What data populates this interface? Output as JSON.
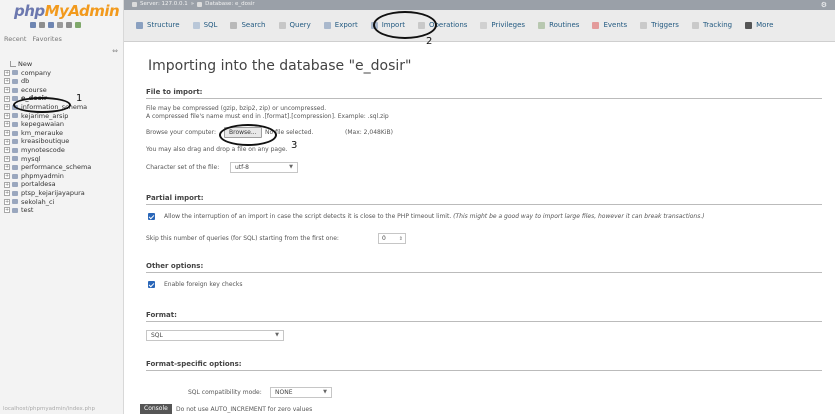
{
  "app": {
    "logo_left": "php",
    "logo_right": "MyAdmin",
    "nav_tabs": [
      "Recent",
      "Favorites"
    ],
    "collapse_glyph": "⇔",
    "status_url": "localhost/phpmyadmin/index.php"
  },
  "tree": [
    {
      "label": "New",
      "kind": "new"
    },
    {
      "label": "company",
      "kind": "db"
    },
    {
      "label": "db",
      "kind": "db"
    },
    {
      "label": "ecourse",
      "kind": "db"
    },
    {
      "label": "e_dosir",
      "kind": "db",
      "selected": true
    },
    {
      "label": "information_schema",
      "kind": "db"
    },
    {
      "label": "kejarime_arsip",
      "kind": "db"
    },
    {
      "label": "kepegawaian",
      "kind": "db"
    },
    {
      "label": "km_merauke",
      "kind": "db"
    },
    {
      "label": "kreasiboutique",
      "kind": "db"
    },
    {
      "label": "mynotescode",
      "kind": "db"
    },
    {
      "label": "mysql",
      "kind": "db"
    },
    {
      "label": "performance_schema",
      "kind": "db"
    },
    {
      "label": "phpmyadmin",
      "kind": "db"
    },
    {
      "label": "portaldesa",
      "kind": "db"
    },
    {
      "label": "ptsp_kejarijayapura",
      "kind": "db"
    },
    {
      "label": "sekolah_ci",
      "kind": "db"
    },
    {
      "label": "test",
      "kind": "db"
    }
  ],
  "breadcrumb": {
    "server": "Server: 127.0.0.1",
    "separator": "»",
    "database": "Database: e_dosir"
  },
  "tabs": [
    {
      "label": "Structure",
      "icon": "structure-icon",
      "color": "#8aa0c0"
    },
    {
      "label": "SQL",
      "icon": "sql-icon",
      "color": "#b9c7d8"
    },
    {
      "label": "Search",
      "icon": "search-icon",
      "color": "#b9b9b9"
    },
    {
      "label": "Query",
      "icon": "query-icon",
      "color": "#c7c7c7"
    },
    {
      "label": "Export",
      "icon": "export-icon",
      "color": "#a9b8cc"
    },
    {
      "label": "Import",
      "icon": "import-icon",
      "color": "#a9b8cc"
    },
    {
      "label": "Operations",
      "icon": "operations-icon",
      "color": "#c9c9c9"
    },
    {
      "label": "Privileges",
      "icon": "privileges-icon",
      "color": "#d0d0d0"
    },
    {
      "label": "Routines",
      "icon": "routines-icon",
      "color": "#b8c8b0"
    },
    {
      "label": "Events",
      "icon": "events-icon",
      "color": "#e39b9b"
    },
    {
      "label": "Triggers",
      "icon": "triggers-icon",
      "color": "#c9c9c9"
    },
    {
      "label": "Tracking",
      "icon": "tracking-icon",
      "color": "#c9c9c9"
    },
    {
      "label": "More",
      "icon": "chevron-down-icon",
      "color": "#555555"
    }
  ],
  "page": {
    "title": "Importing into the database \"e_dosir\""
  },
  "file_import": {
    "heading": "File to import:",
    "hint1": "File may be compressed (gzip, bzip2, zip) or uncompressed.",
    "hint2": "A compressed file's name must end in .[format].[compression]. Example: .sql.zip",
    "browse_label": "Browse your computer:",
    "browse_button": "Browse...",
    "no_file": "No file selected.",
    "max_size": "(Max: 2,048KiB)",
    "drag_hint": "You may also drag and drop a file on any page.",
    "charset_label": "Character set of the file:",
    "charset_value": "utf-8"
  },
  "partial_import": {
    "heading": "Partial import:",
    "allow_interrupt": "Allow the interruption of an import in case the script detects it is close to the PHP timeout limit.",
    "allow_interrupt_note": "(This might be a good way to import large files, however it can break transactions.)",
    "skip_label": "Skip this number of queries (for SQL) starting from the first one:",
    "skip_value": "0"
  },
  "other_options": {
    "heading": "Other options:",
    "fk_checks": "Enable foreign key checks"
  },
  "format": {
    "heading": "Format:",
    "value": "SQL"
  },
  "format_specific": {
    "heading": "Format-specific options:",
    "compat_label": "SQL compatibility mode:",
    "compat_value": "NONE",
    "auto_inc": "Do not use AUTO_INCREMENT for zero values"
  },
  "console": {
    "label": "Console"
  },
  "annotations": [
    "1",
    "2",
    "3"
  ]
}
